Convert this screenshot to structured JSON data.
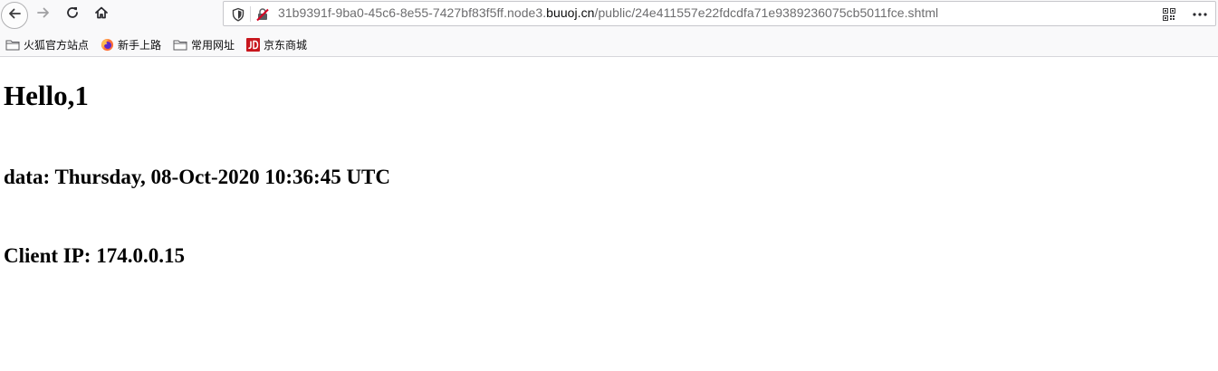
{
  "browser": {
    "url": {
      "prefix": "31b9391f-9ba0-45c6-8e55-7427bf83f5ff.node3.",
      "domain": "buuoj.cn",
      "path": "/public/24e411557e22fdcdfa71e9389236075cb5011fce.shtml"
    },
    "icons": {
      "back": "back-arrow-icon",
      "forward": "forward-arrow-icon",
      "reload": "reload-icon",
      "home": "home-icon",
      "tracking": "shield-icon",
      "insecure": "insecure-lock-icon",
      "qr": "qr-code-icon",
      "more": "more-dots-icon"
    },
    "bookmarks": [
      {
        "label": "火狐官方站点",
        "icon": "folder-icon"
      },
      {
        "label": "新手上路",
        "icon": "firefox-icon"
      },
      {
        "label": "常用网址",
        "icon": "folder-icon"
      },
      {
        "label": "京东商城",
        "icon": "jd-icon"
      }
    ]
  },
  "page": {
    "greeting": "Hello,1",
    "date_line": "data: Thursday, 08-Oct-2020 10:36:45 UTC",
    "ip_line": "Client IP: 174.0.0.15"
  },
  "colors": {
    "toolbar_bg": "#f9f9fa",
    "jd_red": "#c8161d",
    "insecure_red": "#d70022"
  }
}
